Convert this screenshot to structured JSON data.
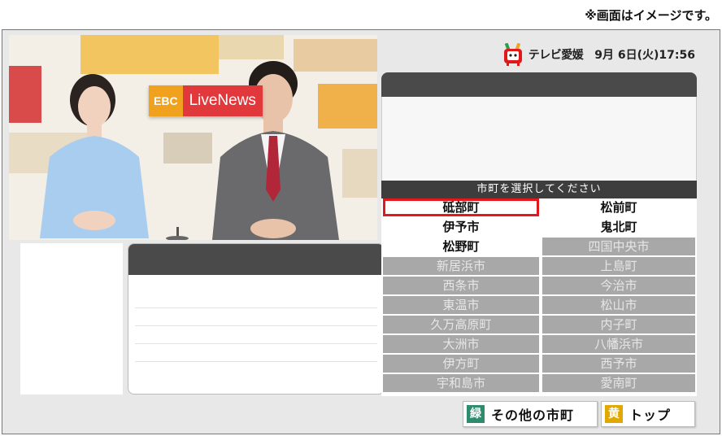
{
  "note": "※画面はイメージです。",
  "header": {
    "brand": "テレビ愛媛",
    "datetime": "9月 6日(火)17:56",
    "mascot_icon": "tv-mascot-icon"
  },
  "video": {
    "logo_left": "EBC",
    "logo_right": "LiveNews"
  },
  "selector": {
    "prompt": "市町を選択してください",
    "selected": "砥部町",
    "municipalities": [
      {
        "name": "砥部町",
        "active": true
      },
      {
        "name": "松前町",
        "active": true
      },
      {
        "name": "伊予市",
        "active": true
      },
      {
        "name": "鬼北町",
        "active": true
      },
      {
        "name": "松野町",
        "active": true
      },
      {
        "name": "四国中央市",
        "active": false
      },
      {
        "name": "新居浜市",
        "active": false
      },
      {
        "name": "上島町",
        "active": false
      },
      {
        "name": "西条市",
        "active": false
      },
      {
        "name": "今治市",
        "active": false
      },
      {
        "name": "東温市",
        "active": false
      },
      {
        "name": "松山市",
        "active": false
      },
      {
        "name": "久万高原町",
        "active": false
      },
      {
        "name": "内子町",
        "active": false
      },
      {
        "name": "大洲市",
        "active": false
      },
      {
        "name": "八幡浜市",
        "active": false
      },
      {
        "name": "伊方町",
        "active": false
      },
      {
        "name": "西予市",
        "active": false
      },
      {
        "name": "宇和島市",
        "active": false
      },
      {
        "name": "愛南町",
        "active": false
      }
    ]
  },
  "buttons": {
    "green_key": "緑",
    "green_label": "その他の市町",
    "yellow_key": "黄",
    "yellow_label": "トップ"
  },
  "colors": {
    "green_key": "#2e8b6e",
    "yellow_key": "#e0a800",
    "selection": "#e1191b",
    "header_bar": "#4a4a4a"
  }
}
